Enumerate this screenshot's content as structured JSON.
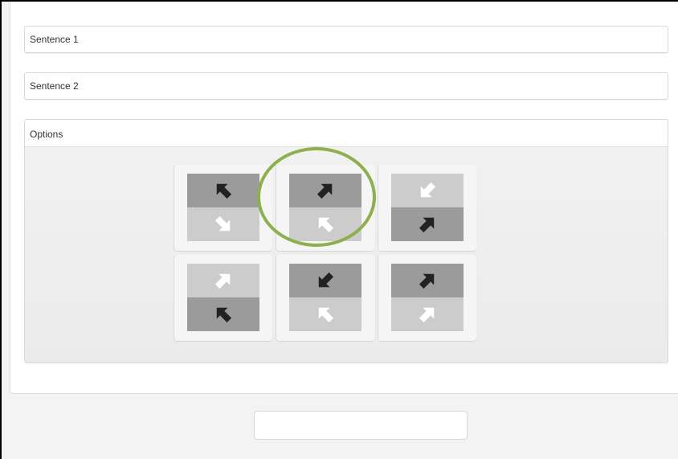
{
  "sentence1": {
    "label": "Sentence 1"
  },
  "sentence2": {
    "label": "Sentence 2"
  },
  "options": {
    "label": "Options",
    "selected_index": 1,
    "highlight_color": "#8daf4e",
    "colors": {
      "dark_bg": "#9b9b9b",
      "light_bg": "#cccccc",
      "dark_arrow": "#222222",
      "light_arrow": "#ffffff"
    },
    "tiles": [
      {
        "top": {
          "bg": "dark",
          "arrow": "up-left",
          "arrow_color": "dark"
        },
        "bottom": {
          "bg": "light",
          "arrow": "down-right",
          "arrow_color": "light"
        }
      },
      {
        "top": {
          "bg": "dark",
          "arrow": "up-right",
          "arrow_color": "dark"
        },
        "bottom": {
          "bg": "light",
          "arrow": "up-left",
          "arrow_color": "light"
        }
      },
      {
        "top": {
          "bg": "light",
          "arrow": "down-left",
          "arrow_color": "light"
        },
        "bottom": {
          "bg": "dark",
          "arrow": "up-right",
          "arrow_color": "dark"
        }
      },
      {
        "top": {
          "bg": "light",
          "arrow": "up-right",
          "arrow_color": "light"
        },
        "bottom": {
          "bg": "dark",
          "arrow": "up-left",
          "arrow_color": "dark"
        }
      },
      {
        "top": {
          "bg": "dark",
          "arrow": "down-left",
          "arrow_color": "dark"
        },
        "bottom": {
          "bg": "light",
          "arrow": "up-left",
          "arrow_color": "light"
        }
      },
      {
        "top": {
          "bg": "dark",
          "arrow": "up-right",
          "arrow_color": "dark"
        },
        "bottom": {
          "bg": "light",
          "arrow": "up-right",
          "arrow_color": "light"
        }
      }
    ]
  },
  "submit": {
    "label": ""
  }
}
